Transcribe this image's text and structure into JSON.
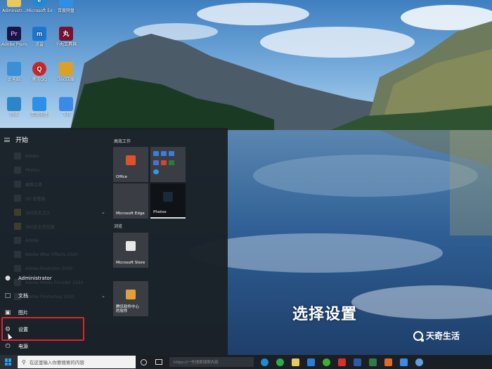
{
  "desktop": {
    "icons": [
      {
        "label": "Administr...",
        "glyph": "",
        "color": "#e8c860"
      },
      {
        "label": "Microsoft Edge",
        "glyph": "e",
        "color": "#1f8ad6"
      },
      {
        "label": "百度网盘",
        "glyph": "",
        "color": "#2e8fe8"
      },
      {
        "label": "Adobe Premie...",
        "glyph": "Pr",
        "color": "#1b1446"
      },
      {
        "label": "迅雷",
        "glyph": "m",
        "color": "#1976d2"
      },
      {
        "label": "小丸工具箱",
        "glyph": "丸",
        "color": "#7b1030"
      },
      {
        "label": "此电脑",
        "glyph": "",
        "color": "#3a8fd6"
      },
      {
        "label": "腾讯QQ",
        "glyph": "Q",
        "color": "#c9262c"
      },
      {
        "label": "360压缩",
        "glyph": "",
        "color": "#d9a12a"
      },
      {
        "label": "网络",
        "glyph": "",
        "color": "#2c85c8"
      },
      {
        "label": "百度网盘",
        "glyph": "",
        "color": "#2e8fe8"
      },
      {
        "label": "飞书",
        "glyph": "",
        "color": "#3b8ae8"
      }
    ]
  },
  "start_menu": {
    "header": "开始",
    "faded_items": [
      "Adobe",
      "Photos",
      "截图工具",
      "3D 查看器",
      "360安全卫士",
      "360安全浏览器",
      "Adobe",
      "Adobe After Effects 2020",
      "Adobe Illustrator 2020",
      "Adobe Media Encoder 2020",
      "Adobe Photoshop 2020"
    ],
    "user": "Administrator",
    "documents": "文档",
    "pictures": "图片",
    "settings": "设置",
    "power": "电源",
    "group_productivity": "高效工作",
    "group_explore": "浏览",
    "tiles": {
      "office": "Office",
      "edge": "Microsoft Edge",
      "photos": "Photos",
      "store": "Microsoft Store",
      "app": "腾讯软件中心\n的软件"
    }
  },
  "caption": "选择设置",
  "watermark": "天奇生活",
  "taskbar": {
    "search_placeholder": "在这里输入你要搜索的内容",
    "address_placeholder": "https://一些搜索搜索内容"
  },
  "colors": {
    "highlight": "#e0232b",
    "taskbar": "#1b1f24",
    "accent": "#2a9fe6"
  }
}
